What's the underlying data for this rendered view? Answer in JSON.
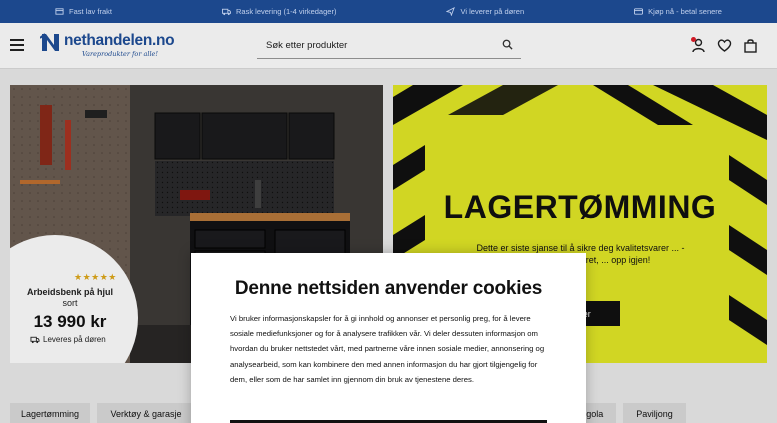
{
  "topbar": {
    "usps": [
      {
        "icon": "tag-icon",
        "label": "Fast lav frakt"
      },
      {
        "icon": "truck-icon",
        "label": "Rask levering (1-4 virkedager)"
      },
      {
        "icon": "plane-icon",
        "label": "Vi leverer på døren"
      },
      {
        "icon": "card-icon",
        "label": "Kjøp nå - betal senere"
      }
    ]
  },
  "header": {
    "logo_text": "nethandelen.no",
    "logo_tagline": "Vareprodukter for alle!",
    "search_placeholder": "Søk etter produkter"
  },
  "hero_left": {
    "stars": "★★★★★",
    "product_line1": "Arbeidsbenk på hjul",
    "product_line2": "sort",
    "price": "13 990 kr",
    "delivery": "Leveres på døren"
  },
  "hero_right": {
    "title": "LAGERTØMMING",
    "subtitle": "Dette er siste sjanse til å sikre deg kvalitetsvarer ... - når vi tømmer lageret, ... opp igjen!",
    "button_label": "...her"
  },
  "categories": [
    "Lagertømming",
    "Verktøy & garasje",
    "...gola",
    "Paviljong"
  ],
  "cookie": {
    "title": "Denne nettsiden anvender cookies",
    "body": "Vi bruker informasjonskapsler for å gi innhold og annonser et personlig preg, for å levere sosiale mediefunksjoner og for å analysere trafikken vår. Vi deler dessuten informasjon om hvordan du bruker nettstedet vårt, med partnerne våre innen sosiale medier, annonsering og analysearbeid, som kan kombinere den med annen informasjon du har gjort tilgjengelig for dem, eller som de har samlet inn gjennom din bruk av tjenestene deres."
  },
  "colors": {
    "brand_blue": "#1f4f9a",
    "hero_yellow": "#e3e927",
    "notification_red": "#e11d2a"
  }
}
